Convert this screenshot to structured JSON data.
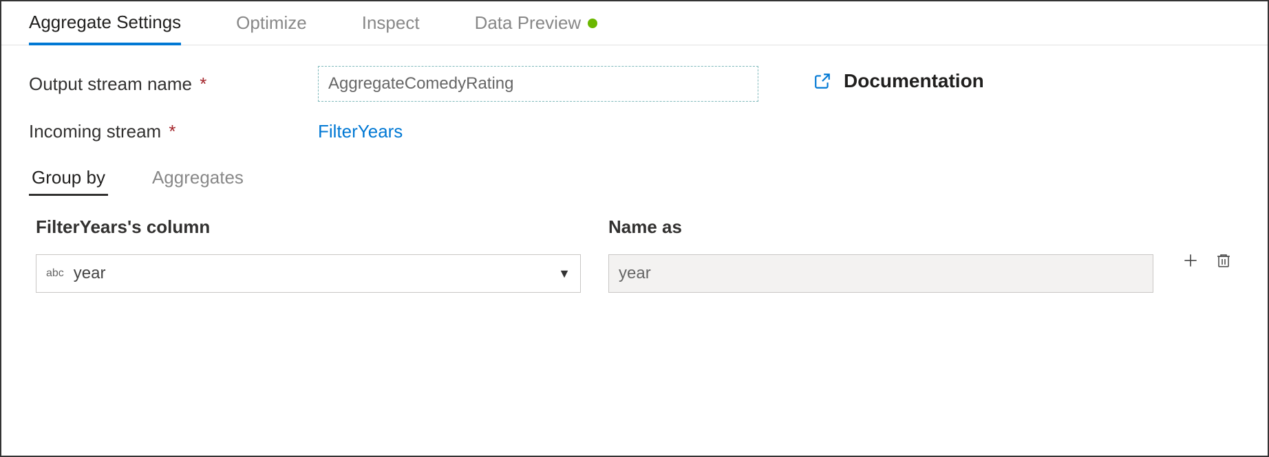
{
  "tabs": {
    "aggregate_settings": "Aggregate Settings",
    "optimize": "Optimize",
    "inspect": "Inspect",
    "data_preview": "Data Preview"
  },
  "form": {
    "output_stream_label": "Output stream name",
    "output_stream_value": "AggregateComedyRating",
    "incoming_stream_label": "Incoming stream",
    "incoming_stream_value": "FilterYears"
  },
  "documentation_label": "Documentation",
  "subtabs": {
    "group_by": "Group by",
    "aggregates": "Aggregates"
  },
  "columns": {
    "source_header": "FilterYears's column",
    "alias_header": "Name as",
    "type_prefix": "abc",
    "source_value": "year",
    "alias_value": "year"
  }
}
